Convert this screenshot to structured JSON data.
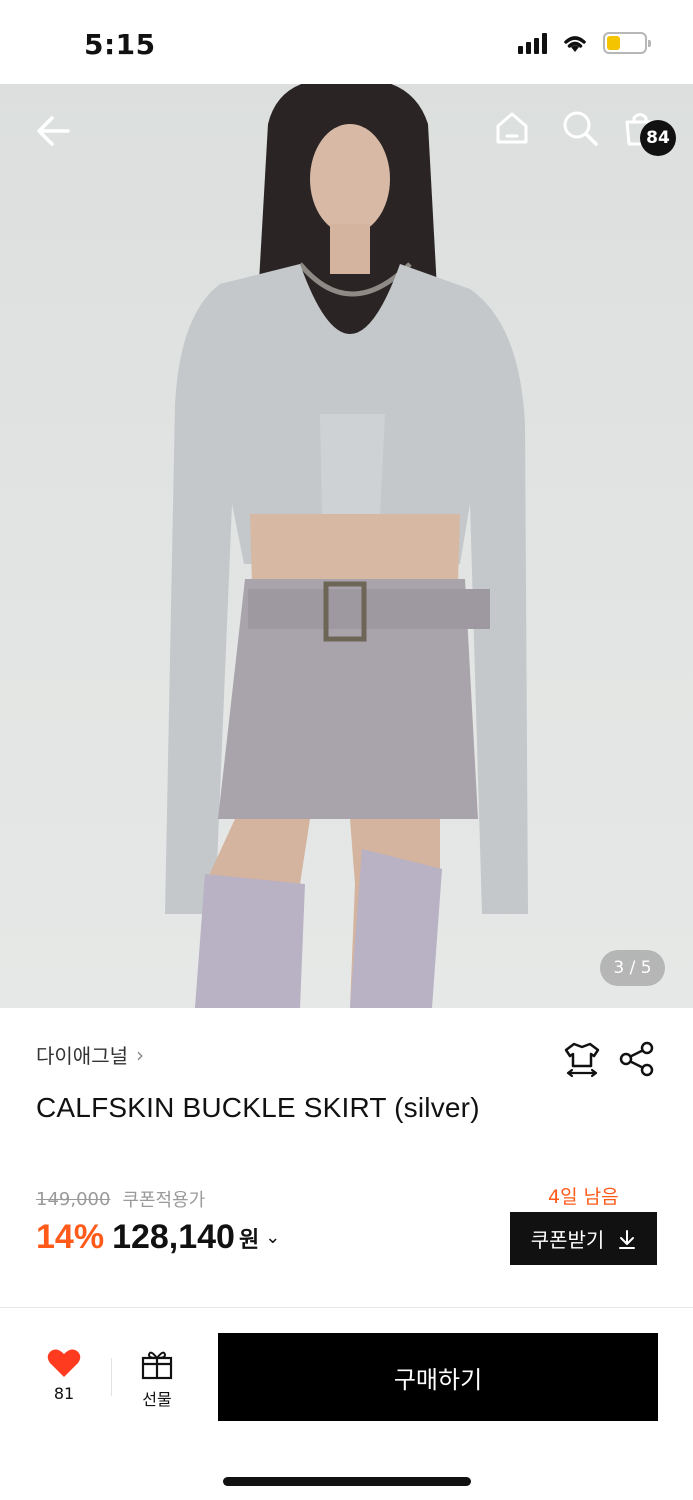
{
  "status_bar": {
    "time": "5:15"
  },
  "hero": {
    "image_counter": "3 / 5",
    "cart_count": "84",
    "icons": [
      "back-arrow-icon",
      "home-icon",
      "search-icon",
      "shopping-bag-icon"
    ]
  },
  "product": {
    "brand": "다이애그널",
    "title": "CALFSKIN BUCKLE SKIRT (silver)",
    "original_price": "149,000",
    "coupon_note": "쿠폰적용가",
    "discount": "14%",
    "sale_price": "128,140",
    "currency": "원",
    "days_left": "4일 남음",
    "coupon_button_label": "쿠폰받기"
  },
  "bottom_bar": {
    "like_count": "81",
    "gift_label": "선물",
    "buy_label": "구매하기"
  },
  "colors": {
    "accent": "#ff5a1a",
    "primary_button": "#000000",
    "heart": "#ff3b1f"
  }
}
